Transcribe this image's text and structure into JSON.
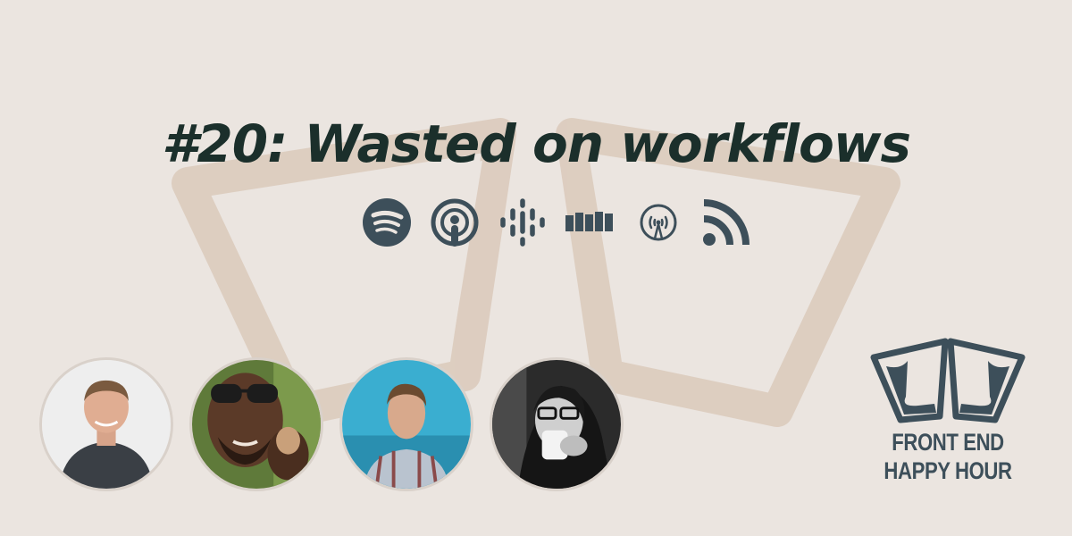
{
  "episode": {
    "title": "#20: Wasted on workflows"
  },
  "platforms": [
    {
      "name": "Spotify",
      "icon": "spotify-icon"
    },
    {
      "name": "Apple Podcasts",
      "icon": "apple-podcasts-icon"
    },
    {
      "name": "Google Podcasts",
      "icon": "google-podcasts-icon"
    },
    {
      "name": "Stitcher",
      "icon": "stitcher-icon"
    },
    {
      "name": "Overcast",
      "icon": "overcast-icon"
    },
    {
      "name": "RSS",
      "icon": "rss-icon"
    }
  ],
  "hosts_count_shown": 4,
  "logo": {
    "line1": "FRONT END",
    "line2": "HAPPY HOUR"
  },
  "colors": {
    "background": "#ebe5e0",
    "title": "#1b2f2b",
    "icons": "#3d4f5a",
    "watermark": "#dccbbd"
  }
}
